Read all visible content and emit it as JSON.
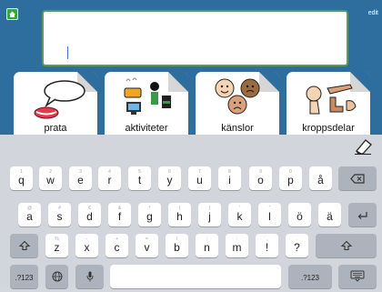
{
  "header": {
    "edit_label": "edit"
  },
  "message": {
    "value": ""
  },
  "tiles": [
    {
      "label": "prata",
      "icon": "speech-bubble-mouth-icon"
    },
    {
      "label": "aktiviteter",
      "icon": "activities-icon"
    },
    {
      "label": "känslor",
      "icon": "faces-emotions-icon"
    },
    {
      "label": "kroppsdelar",
      "icon": "body-parts-icon"
    }
  ],
  "keyboard": {
    "row1": [
      {
        "label": "q",
        "hint": "1"
      },
      {
        "label": "w",
        "hint": "2"
      },
      {
        "label": "e",
        "hint": "3"
      },
      {
        "label": "r",
        "hint": "4"
      },
      {
        "label": "t",
        "hint": "5"
      },
      {
        "label": "y",
        "hint": "6"
      },
      {
        "label": "u",
        "hint": "7"
      },
      {
        "label": "i",
        "hint": "8"
      },
      {
        "label": "o",
        "hint": "9"
      },
      {
        "label": "p",
        "hint": "0"
      },
      {
        "label": "å",
        "hint": ""
      }
    ],
    "row2": [
      {
        "label": "a",
        "hint": "@"
      },
      {
        "label": "s",
        "hint": "#"
      },
      {
        "label": "d",
        "hint": "€"
      },
      {
        "label": "f",
        "hint": "&"
      },
      {
        "label": "g",
        "hint": "*"
      },
      {
        "label": "h",
        "hint": "("
      },
      {
        "label": "j",
        "hint": ")"
      },
      {
        "label": "k",
        "hint": "'"
      },
      {
        "label": "l",
        "hint": "\""
      },
      {
        "label": "ö",
        "hint": ""
      },
      {
        "label": "ä",
        "hint": ""
      }
    ],
    "row3": [
      {
        "label": "z",
        "hint": "%"
      },
      {
        "label": "x",
        "hint": "-"
      },
      {
        "label": "c",
        "hint": "+"
      },
      {
        "label": "v",
        "hint": "="
      },
      {
        "label": "b",
        "hint": "/"
      },
      {
        "label": "n",
        "hint": ";"
      },
      {
        "label": "m",
        "hint": ":"
      },
      {
        "label": "!",
        "hint": ","
      },
      {
        "label": "?",
        "hint": "."
      }
    ],
    "numbers_label": ".?123",
    "numbers_label_right": ".?123"
  }
}
